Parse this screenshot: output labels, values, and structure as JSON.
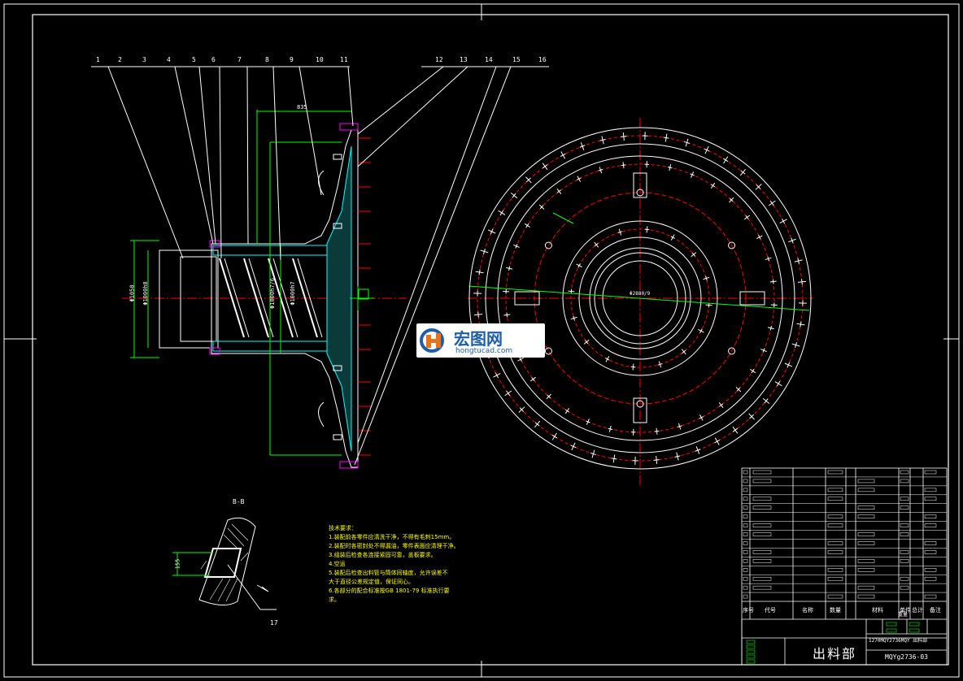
{
  "drawing": {
    "title": "出料部",
    "drawing_number": "MQYg2736-03",
    "subtitle": "1270MQY2736MQY 出料部",
    "section_label": "B-B",
    "balloons": [
      "1",
      "2",
      "3",
      "4",
      "5",
      "6",
      "7",
      "8",
      "9",
      "10",
      "11",
      "12",
      "13",
      "14",
      "15",
      "16"
    ],
    "section_balloon": "17",
    "section_dim": "155",
    "dims": {
      "d1": "Φ1050",
      "d2": "Φ1000h8",
      "d3": "Φ1000h7/6",
      "d4": "Φ1270h8",
      "d5": "Φ1000h7",
      "d6": "Φ2880/9",
      "len": "835"
    },
    "notes_title": "技术要求：",
    "notes": [
      "1.装配前各零件应清洗干净，不得有毛刺15mm。",
      "2.装配时各密封处不得漏油，零件表面应清理干净。",
      "3.组装后检查各连接紧固可靠，盖板要求。",
      "4.空运",
      "5.装配后检查出料管与筒体同轴度，允许误差不",
      "  大于直径公差规定值，保证同心。",
      "6.各部分的配合标准按GB 1801-79 标准执行要",
      "  求。"
    ],
    "table_footer": [
      "序号",
      "代号",
      "名称",
      "数量",
      "材料",
      "单件",
      "总计",
      "备注"
    ],
    "table_weight_label": "重量",
    "watermark_name": "宏图网",
    "watermark_url": "hongtucad.com"
  },
  "colors": {
    "background": "#000000",
    "line": "#ffffff",
    "centerline": "#ff0000",
    "dimension": "#00ff00",
    "hatch": "#00ffff",
    "magenta": "#ff00ff",
    "text_yellow": "#ffff00",
    "watermark_blue": "#1e5ea8",
    "watermark_orange": "#e8731a"
  }
}
